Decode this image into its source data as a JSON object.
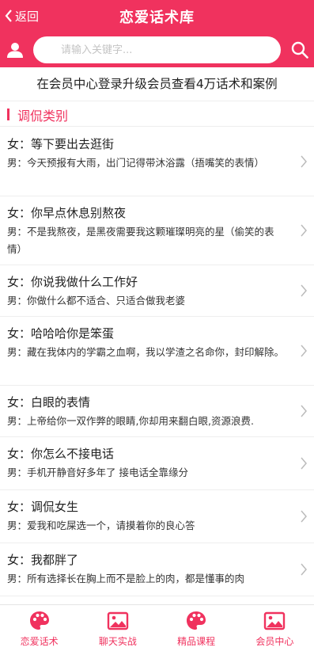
{
  "header": {
    "back_label": "返回",
    "title": "恋爱话术库"
  },
  "search": {
    "placeholder": "请输入关键字..."
  },
  "notice": "在会员中心登录升级会员查看4万话术和案例",
  "section": {
    "title": "调侃类别"
  },
  "items": [
    {
      "q": "女：等下要出去逛街",
      "a": "男：今天预报有大雨，出门记得带沐浴露（捂嘴笑的表情）"
    },
    {
      "q": "女：你早点休息别熬夜",
      "a": "男：不是我熬夜，是黑夜需要我这颗璀璨明亮的星（偷笑的表情）"
    },
    {
      "q": "女：你说我做什么工作好",
      "a": "男：你做什么都不适合、只适合做我老婆"
    },
    {
      "q": "女：哈哈哈你是笨蛋",
      "a": "男：藏在我体内的学霸之血啊，我以学渣之名命你，封印解除。"
    },
    {
      "q": "女：白眼的表情",
      "a": "男：上帝给你一双作弊的眼睛,你却用来翻白眼,资源浪费."
    },
    {
      "q": "女：你怎么不接电话",
      "a": "男：手机开静音好多年了 接电话全靠缘分"
    },
    {
      "q": "女：调侃女生",
      "a": "男：爱我和吃屎选一个，请摸着你的良心答"
    },
    {
      "q": "女：我都胖了",
      "a": "男：所有选择长在胸上而不是脸上的肉，都是懂事的肉"
    }
  ],
  "tabs": [
    {
      "label": "恋爱话术",
      "icon": "palette-icon"
    },
    {
      "label": "聊天实战",
      "icon": "image-icon"
    },
    {
      "label": "精品课程",
      "icon": "palette-icon"
    },
    {
      "label": "会员中心",
      "icon": "image-icon"
    }
  ],
  "colors": {
    "accent": "#f0325e"
  }
}
